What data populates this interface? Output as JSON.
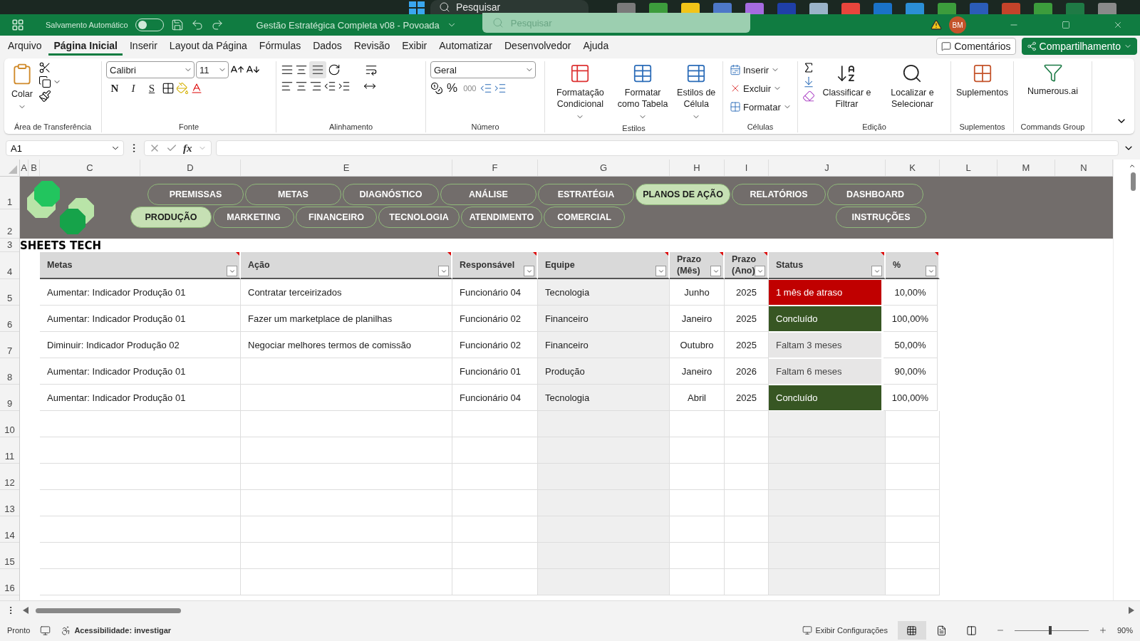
{
  "taskbar": {
    "search_placeholder": "Pesquisar"
  },
  "title_bar": {
    "autosave_label": "Salvamento Automático",
    "autosave_on": false,
    "title": "Gestão Estratégica Completa v08 - Povoada",
    "search_placeholder": "Pesquisar",
    "avatar": "BM"
  },
  "menu": {
    "tabs": [
      {
        "label": "Arquivo",
        "selected": false
      },
      {
        "label": "Página Inicial",
        "selected": true
      },
      {
        "label": "Inserir",
        "selected": false
      },
      {
        "label": "Layout da Página",
        "selected": false
      },
      {
        "label": "Fórmulas",
        "selected": false
      },
      {
        "label": "Dados",
        "selected": false
      },
      {
        "label": "Revisão",
        "selected": false
      },
      {
        "label": "Exibir",
        "selected": false
      },
      {
        "label": "Automatizar",
        "selected": false
      },
      {
        "label": "Desenvolvedor",
        "selected": false
      },
      {
        "label": "Ajuda",
        "selected": false
      }
    ],
    "comments_button": "Comentários",
    "share_button": "Compartilhamento"
  },
  "ribbon": {
    "clipboard": {
      "label": "Área de Transferência",
      "paste": "Colar"
    },
    "font": {
      "label": "Fonte",
      "family": "Calibri",
      "size": "11",
      "bold": "N",
      "italic": "I",
      "underline": "S"
    },
    "alignment": {
      "label": "Alinhamento"
    },
    "number": {
      "label": "Número",
      "format": "Geral",
      "percent": "%",
      "thousands": "000"
    },
    "styles": {
      "label": "Estilos",
      "buttons": [
        "Formatação Condicional",
        "Formatar como Tabela",
        "Estilos de Célula"
      ]
    },
    "cells": {
      "label": "Células",
      "buttons": [
        "Inserir",
        "Excluir",
        "Formatar"
      ]
    },
    "editing": {
      "label": "Edição",
      "buttons": [
        "Classificar e Filtrar",
        "Localizar e Selecionar"
      ]
    },
    "addins": {
      "label": "Suplementos",
      "button": "Suplementos"
    },
    "commands": {
      "label": "Commands Group",
      "button": "Numerous.ai"
    }
  },
  "formula_bar": {
    "name_box": "A1",
    "fx": "fx"
  },
  "sheet": {
    "columns": [
      "A",
      "B",
      "C",
      "D",
      "E",
      "F",
      "G",
      "H",
      "I",
      "J",
      "K",
      "L",
      "M",
      "N"
    ],
    "row_numbers": [
      "1",
      "2",
      "3",
      "4",
      "5",
      "6",
      "7",
      "8",
      "9",
      "10",
      "11",
      "12",
      "13",
      "14",
      "15",
      "16"
    ],
    "nav_row_1": [
      {
        "label": "PREMISSAS",
        "selected": false
      },
      {
        "label": "METAS",
        "selected": false
      },
      {
        "label": "DIAGNÓSTICO",
        "selected": false
      },
      {
        "label": "ANÁLISE",
        "selected": false
      },
      {
        "label": "ESTRATÉGIA",
        "selected": false
      },
      {
        "label": "PLANOS DE AÇÃO",
        "selected": true
      },
      {
        "label": "RELATÓRIOS",
        "selected": false
      },
      {
        "label": "DASHBOARD",
        "selected": false
      }
    ],
    "nav_row_2": [
      {
        "label": "PRODUÇÃO",
        "selected": true
      },
      {
        "label": "MARKETING",
        "selected": false
      },
      {
        "label": "FINANCEIRO",
        "selected": false
      },
      {
        "label": "TECNOLOGIA",
        "selected": false
      },
      {
        "label": "ATENDIMENTO",
        "selected": false
      },
      {
        "label": "COMERCIAL",
        "selected": false
      }
    ],
    "instructions_button": "INSTRUÇÕES",
    "brand": "SHEETS TECH",
    "table": {
      "columns": [
        "Metas",
        "Ação",
        "Responsável",
        "Equipe",
        "Prazo (Mês)",
        "Prazo (Ano)",
        "Status",
        "%"
      ],
      "rows": [
        {
          "meta": "Aumentar: Indicador Produção 01",
          "action": "Contratar terceirizados",
          "owner": "Funcionário 04",
          "team": "Tecnologia",
          "month": "Junho",
          "year": "2025",
          "status": "1 mês de atraso",
          "color": "#c00000",
          "percent": "10,00%"
        },
        {
          "meta": "Aumentar: Indicador Produção 01",
          "action": "Fazer um marketplace de planilhas",
          "owner": "Funcionário 02",
          "team": "Financeiro",
          "month": "Janeiro",
          "year": "2025",
          "status": "Concluído",
          "color": "#375623",
          "percent": "100,00%"
        },
        {
          "meta": "Diminuir: Indicador Produção 02",
          "action": "Negociar melhores termos de comissão",
          "owner": "Funcionário 02",
          "team": "Financeiro",
          "month": "Outubro",
          "year": "2025",
          "status": "Faltam 3 meses",
          "color": "#e7e6e6",
          "percent": "50,00%"
        },
        {
          "meta": "Aumentar: Indicador Produção 01",
          "owner": "Funcionário 01",
          "team": "Produção",
          "month": "Janeiro",
          "year": "2026",
          "status": "Faltam 6 meses",
          "color": "#e7e6e6",
          "percent": "90,00%"
        },
        {
          "meta": "Aumentar: Indicador Produção 01",
          "owner": "Funcionário 04",
          "team": "Tecnologia",
          "month": "Abril",
          "year": "2025",
          "status": "Concluído",
          "color": "#375623",
          "percent": "100,00%"
        }
      ]
    }
  },
  "status_bar": {
    "ready": "Pronto",
    "accessibility": "Acessibilidade: investigar",
    "display_settings": "Exibir Configurações",
    "views": [
      {
        "kind": "normal",
        "selected": true
      },
      {
        "kind": "layout",
        "selected": false
      },
      {
        "kind": "pagebreak",
        "selected": false
      }
    ],
    "zoom": {
      "level": 0.46,
      "reading": "90%"
    }
  }
}
